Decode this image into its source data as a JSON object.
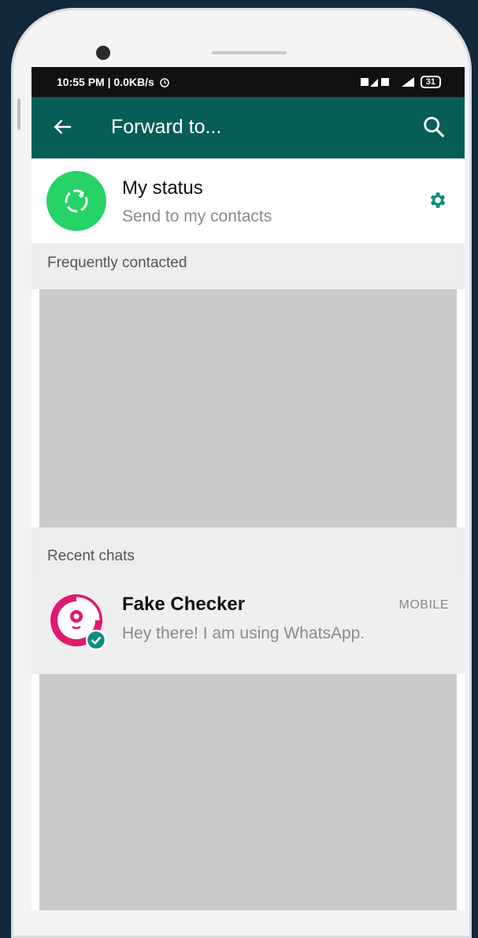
{
  "statusbar": {
    "time": "10:55 PM | 0.0KB/s",
    "battery": "31"
  },
  "appbar": {
    "title": "Forward to..."
  },
  "my_status": {
    "name": "My status",
    "subtitle": "Send to my contacts"
  },
  "sections": {
    "frequent": "Frequently contacted",
    "recent": "Recent chats"
  },
  "chats": [
    {
      "name": "Fake Checker",
      "message": "Hey there! I am using WhatsApp.",
      "tag": "MOBILE"
    }
  ],
  "colors": {
    "appbar": "#075e54",
    "status_green": "#25d366",
    "accent_teal": "#128c7e",
    "avatar_ring": "#e0196d"
  }
}
